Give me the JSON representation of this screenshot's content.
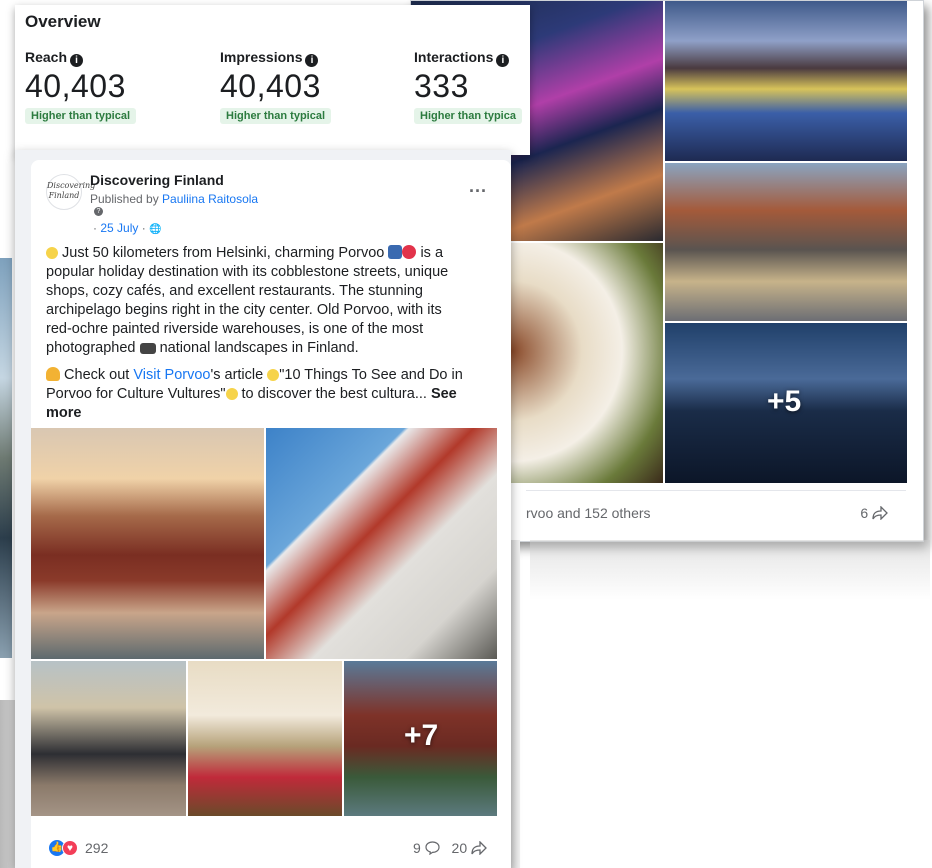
{
  "overview": {
    "title": "Overview",
    "metrics": [
      {
        "label": "Reach",
        "value": "40,403",
        "badge": "Higher than typical"
      },
      {
        "label": "Impressions",
        "value": "40,403",
        "badge": "Higher than typical"
      },
      {
        "label": "Interactions",
        "value": "333",
        "badge": "Higher than typica"
      }
    ],
    "info_glyph": "i"
  },
  "post": {
    "avatar_text": "Discovering Finland",
    "page_name": "Discovering Finland",
    "published_prefix": "Published by ",
    "author": "Pauliina Raitosola",
    "date": "25 July",
    "date_prefix": "· ",
    "date_suffix": " · ",
    "globe": "🌐",
    "menu": "...",
    "text_p1": "Just 50 kilometers from Helsinki, charming Porvoo",
    "text_p1b": "is a popular holiday destination with its cobblestone streets, unique shops, cozy cafés, and excellent restaurants. The stunning archipelago begins right in the city center. Old Porvoo, with its red-ochre painted riverside warehouses, is one of the most photographed",
    "text_p1c": "national landscapes in Finland.",
    "text_p2a": "Check out ",
    "text_p2_link": "Visit Porvoo",
    "text_p2b": "'s article",
    "text_p2c": "\"10 Things To See and Do in Porvoo for Culture Vultures\"",
    "text_p2d": "to discover the best cultura...",
    "see_more": "See more",
    "plus_more": "+7",
    "reactions": "292",
    "comments": "9",
    "shares": "20"
  },
  "background_post": {
    "plus_more": "+5",
    "likes_text": "rvoo and 152 others",
    "shares": "6"
  },
  "icons": {
    "comment": "comment-icon",
    "share": "share-icon",
    "like": "like-reaction-icon",
    "love": "love-reaction-icon"
  },
  "colors": {
    "accent": "#1877f2",
    "badge_bg": "#e5f4e9",
    "badge_text": "#2c7b3f"
  }
}
